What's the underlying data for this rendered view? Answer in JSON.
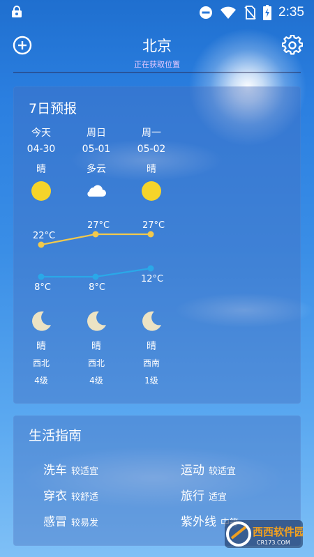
{
  "status_bar": {
    "time": "2:35"
  },
  "header": {
    "city": "北京",
    "locating": "正在获取位置"
  },
  "forecast": {
    "title": "7日预报",
    "days": [
      {
        "day": "今天",
        "date": "04-30",
        "day_weather": "晴",
        "day_icon": "sun-icon",
        "high": "22°C",
        "high_value": 22,
        "low": "8°C",
        "low_value": 8,
        "night_icon": "moon-icon",
        "night_weather": "晴",
        "wind_dir": "西北",
        "wind_level": "4级"
      },
      {
        "day": "周日",
        "date": "05-01",
        "day_weather": "多云",
        "day_icon": "cloud-icon",
        "high": "27°C",
        "high_value": 27,
        "low": "8°C",
        "low_value": 8,
        "night_icon": "moon-icon",
        "night_weather": "晴",
        "wind_dir": "西北",
        "wind_level": "4级"
      },
      {
        "day": "周一",
        "date": "05-02",
        "day_weather": "晴",
        "day_icon": "sun-icon",
        "high": "27°C",
        "high_value": 27,
        "low": "12°C",
        "low_value": 12,
        "night_icon": "moon-icon",
        "night_weather": "晴",
        "wind_dir": "西南",
        "wind_level": "1级"
      }
    ],
    "colors": {
      "high_line": "#f2c94c",
      "low_line": "#2aa8e8",
      "sun": "#f5d42a"
    }
  },
  "guide": {
    "title": "生活指南",
    "items": [
      {
        "name": "洗车",
        "value": "较适宜"
      },
      {
        "name": "运动",
        "value": "较适宜"
      },
      {
        "name": "穿衣",
        "value": "较舒适"
      },
      {
        "name": "旅行",
        "value": "适宜"
      },
      {
        "name": "感冒",
        "value": "较易发"
      },
      {
        "name": "紫外线",
        "value": "中等"
      }
    ]
  },
  "watermark": {
    "text": "西西软件园",
    "subtext": "CR173.COM"
  }
}
